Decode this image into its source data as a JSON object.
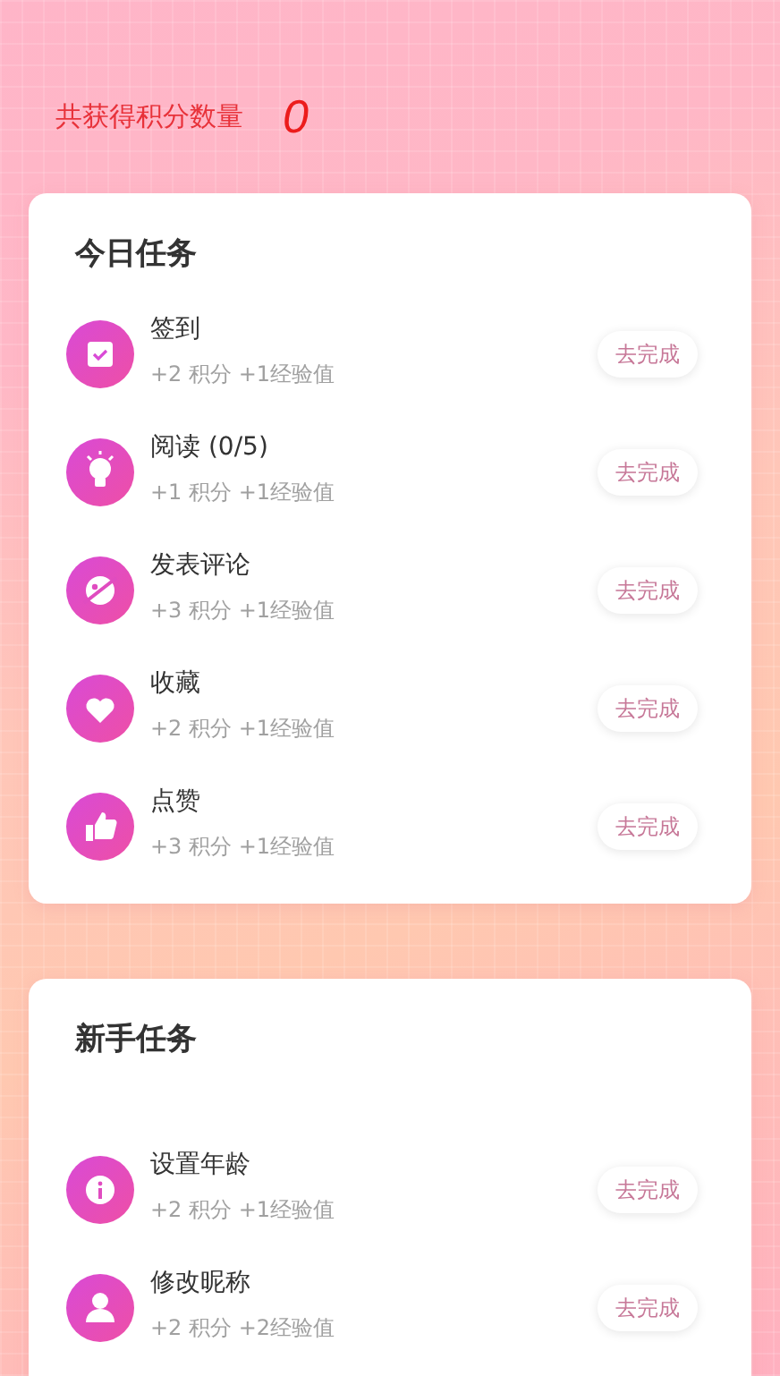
{
  "points": {
    "label": "共获得积分数量",
    "value": "0"
  },
  "sections": [
    {
      "title": "今日任务",
      "tasks": [
        {
          "kind": "check",
          "title": "签到",
          "reward": "+2 积分 +1经验值",
          "button": "去完成"
        },
        {
          "kind": "bulb",
          "title": "阅读 (0/5)",
          "reward": "+1 积分 +1经验值",
          "button": "去完成"
        },
        {
          "kind": "comment",
          "title": "发表评论",
          "reward": "+3 积分 +1经验值",
          "button": "去完成"
        },
        {
          "kind": "heart",
          "title": "收藏",
          "reward": "+2 积分 +1经验值",
          "button": "去完成"
        },
        {
          "kind": "thumb",
          "title": "点赞",
          "reward": "+3 积分 +1经验值",
          "button": "去完成"
        }
      ]
    },
    {
      "title": "新手任务",
      "tasks": [
        {
          "kind": "info",
          "title": "设置年龄",
          "reward": "+2 积分 +1经验值",
          "button": "去完成"
        },
        {
          "kind": "person",
          "title": "修改昵称",
          "reward": "+2 积分 +2经验值",
          "button": "去完成"
        }
      ]
    }
  ]
}
